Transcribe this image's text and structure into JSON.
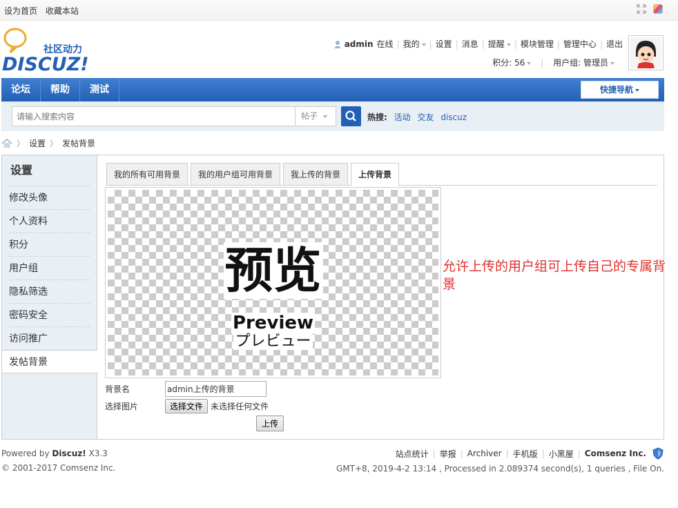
{
  "topbar": {
    "set_home": "设为首页",
    "bookmark": "收藏本站"
  },
  "logo": {
    "tagline": "社区动力",
    "brand": "DISCUZ!"
  },
  "userbar": {
    "username": "admin",
    "online": "在线",
    "items": [
      "我的",
      "设置",
      "消息",
      "提醒",
      "模块管理",
      "管理中心",
      "退出"
    ],
    "points": "积分: 56",
    "usergroup": "用户组: 管理员"
  },
  "nav": {
    "items": [
      "论坛",
      "帮助",
      "测试"
    ],
    "quick_nav": "快捷导航"
  },
  "search": {
    "placeholder": "请输入搜索内容",
    "type": "帖子",
    "hot_label": "热搜:",
    "hot_items": [
      "活动",
      "交友",
      "discuz"
    ]
  },
  "breadcrumb": {
    "items": [
      "设置",
      "发帖背景"
    ]
  },
  "sidebar": {
    "title": "设置",
    "items": [
      "修改头像",
      "个人资料",
      "积分",
      "用户组",
      "隐私筛选",
      "密码安全",
      "访问推广",
      "发帖背景"
    ]
  },
  "tabs": [
    "我的所有可用背景",
    "我的用户组可用背景",
    "我上传的背景",
    "上传背景"
  ],
  "preview": {
    "cn": "预览",
    "en": "Preview",
    "jp": "プレビュー"
  },
  "form": {
    "name_label": "背景名",
    "name_value": "admin上传的背景",
    "file_label": "选择图片",
    "file_button": "选择文件",
    "file_status": "未选择任何文件",
    "upload_button": "上传"
  },
  "annotation": "允许上传的用户组可上传自己的专属背景",
  "footer": {
    "powered_prefix": "Powered by ",
    "powered_brand": "Discuz!",
    "powered_version": " X3.3",
    "copyright": "© 2001-2017 Comsenz Inc.",
    "links": [
      "站点统计",
      "举报",
      "Archiver",
      "手机版",
      "小黑屋"
    ],
    "company": "Comsenz Inc.",
    "processed": "GMT+8, 2019-4-2 13:14 , Processed in 2.089374 second(s), 1 queries , File On."
  }
}
